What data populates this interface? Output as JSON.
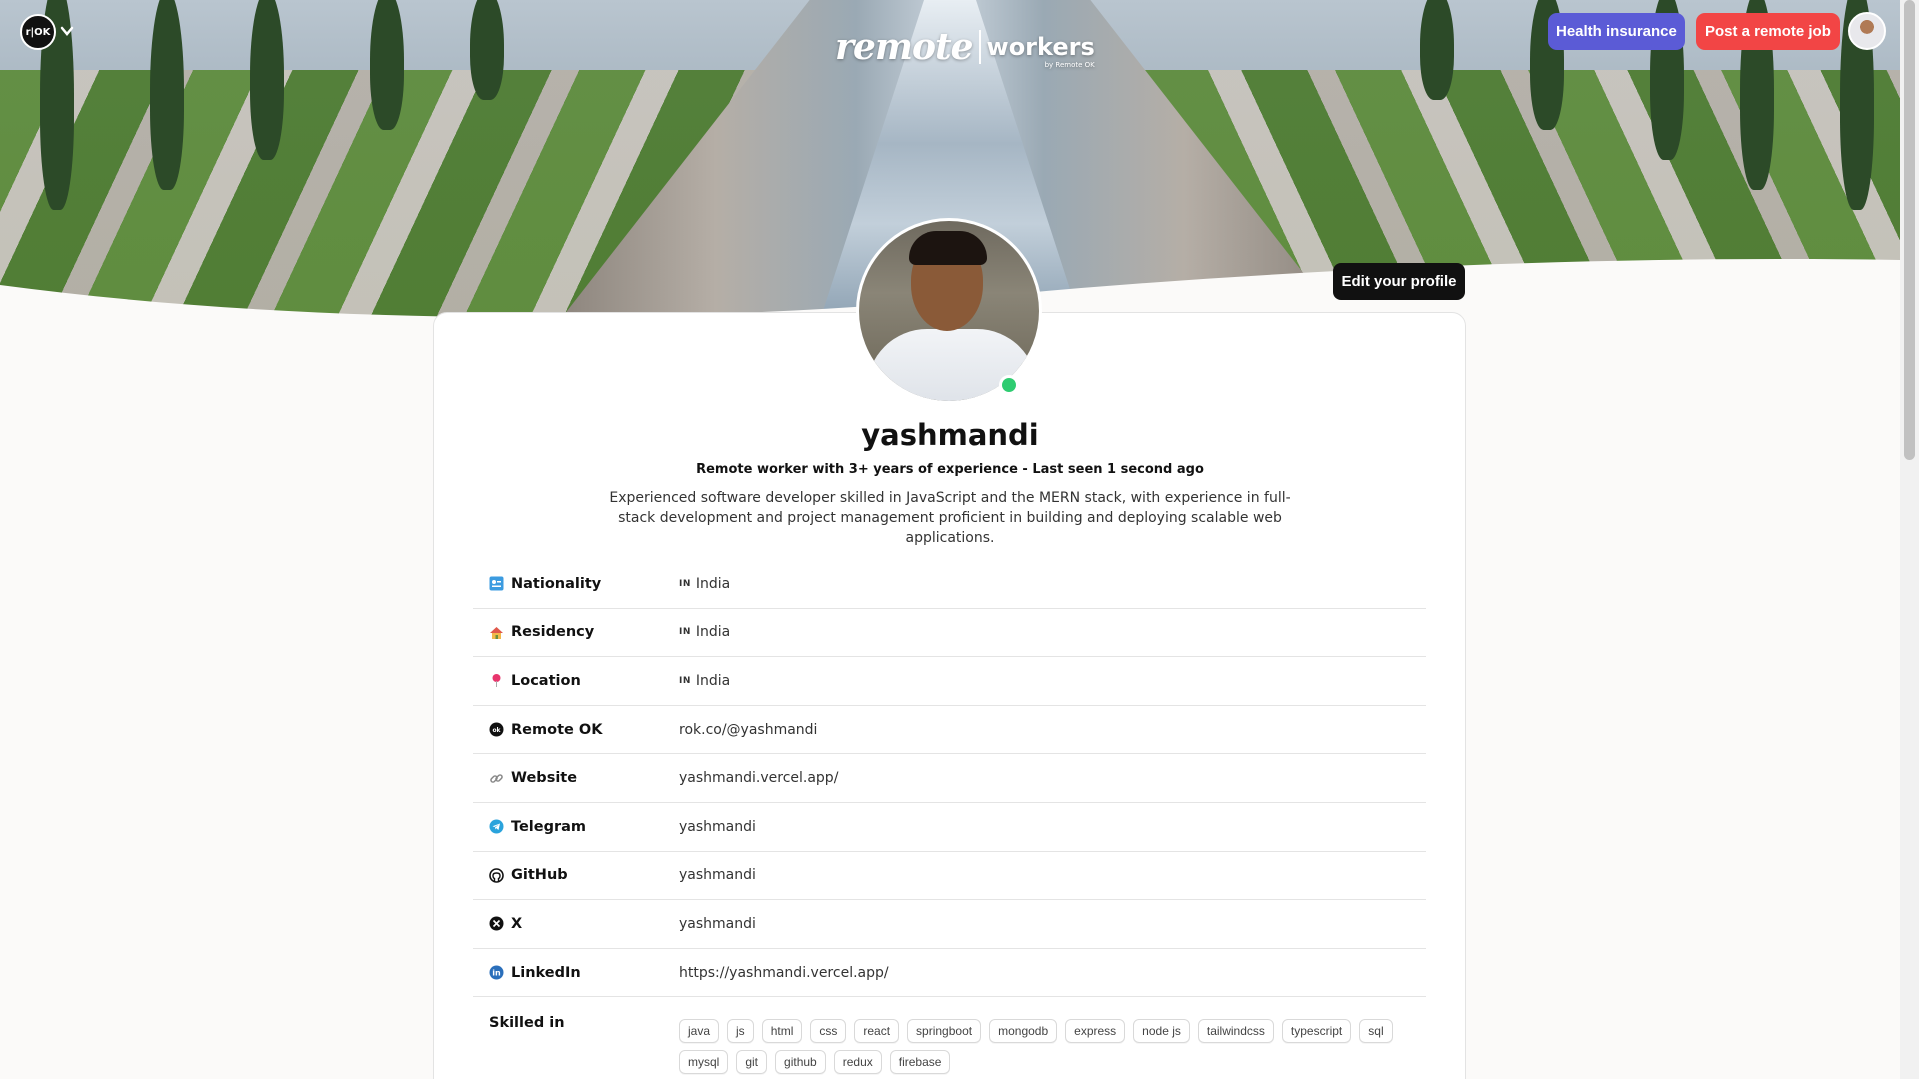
{
  "header": {
    "logo_text": "r|OK",
    "brand_remote": "remote",
    "brand_workers": "workers",
    "brand_by": "by Remote OK",
    "health_label": "Health insurance",
    "post_label": "Post a remote job"
  },
  "profile": {
    "edit_label": "Edit your profile",
    "name": "yashmandi",
    "tagline": "Remote worker with 3+ years of experience - Last seen 1 second ago",
    "bio": "Experienced software developer skilled in JavaScript and the MERN stack, with experience in full-stack development and project management proficient in building and deploying scalable web applications.",
    "status": "online"
  },
  "rows": [
    {
      "label": "Nationality",
      "icon": "id-card-icon",
      "code": "IN",
      "value": "India"
    },
    {
      "label": "Residency",
      "icon": "house-icon",
      "code": "IN",
      "value": "India"
    },
    {
      "label": "Location",
      "icon": "pin-icon",
      "code": "IN",
      "value": "India"
    },
    {
      "label": "Remote OK",
      "icon": "remoteok-icon",
      "code": "",
      "value": "rok.co/@yashmandi"
    },
    {
      "label": "Website",
      "icon": "link-icon",
      "code": "",
      "value": "yashmandi.vercel.app/"
    },
    {
      "label": "Telegram",
      "icon": "telegram-icon",
      "code": "",
      "value": "yashmandi"
    },
    {
      "label": "GitHub",
      "icon": "github-icon",
      "code": "",
      "value": "yashmandi"
    },
    {
      "label": "X",
      "icon": "x-icon",
      "code": "",
      "value": "yashmandi"
    },
    {
      "label": "LinkedIn",
      "icon": "linkedin-icon",
      "code": "",
      "value": "https://yashmandi.vercel.app/"
    }
  ],
  "skills": {
    "label": "Skilled in",
    "tags": [
      "java",
      "js",
      "html",
      "css",
      "react",
      "springboot",
      "mongodb",
      "express",
      "node js",
      "tailwindcss",
      "typescript",
      "sql",
      "mysql",
      "git",
      "github",
      "redux",
      "firebase"
    ]
  },
  "colors": {
    "health_button": "#5b5bd6",
    "post_button": "#f24545",
    "online_dot": "#2ecc71"
  }
}
